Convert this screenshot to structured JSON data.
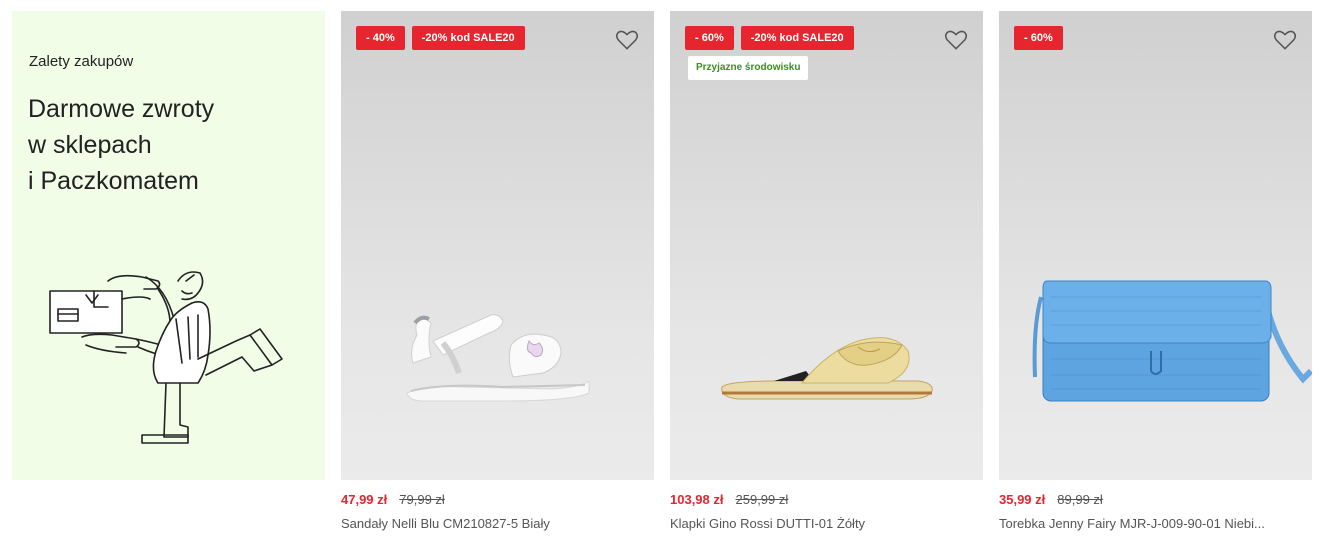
{
  "promo": {
    "eyebrow": "Zalety zakupów",
    "title": "Darmowe zwroty\nw sklepach\ni Paczkomatem"
  },
  "products": [
    {
      "badges": [
        "- 40%",
        "-20% kod SALE20"
      ],
      "eco_badge": "",
      "price_now": "47,99 zł",
      "price_old": "79,99 zł",
      "name": "Sandały Nelli Blu CM210827-5 Biały",
      "icon": "heart-icon"
    },
    {
      "badges": [
        "- 60%",
        "-20% kod SALE20"
      ],
      "eco_badge": "Przyjazne środowisku",
      "price_now": "103,98 zł",
      "price_old": "259,99 zł",
      "name": "Klapki Gino Rossi DUTTI-01 Żółty",
      "icon": "heart-icon"
    },
    {
      "badges": [
        "- 60%"
      ],
      "eco_badge": "",
      "price_now": "35,99 zł",
      "price_old": "89,99 zł",
      "name": "Torebka Jenny Fairy MJR-J-009-90-01 Niebi...",
      "icon": "heart-icon"
    }
  ],
  "colors": {
    "sale_red": "#e6252f",
    "promo_bg": "#f2fde8",
    "eco_green": "#3f8f1c"
  }
}
